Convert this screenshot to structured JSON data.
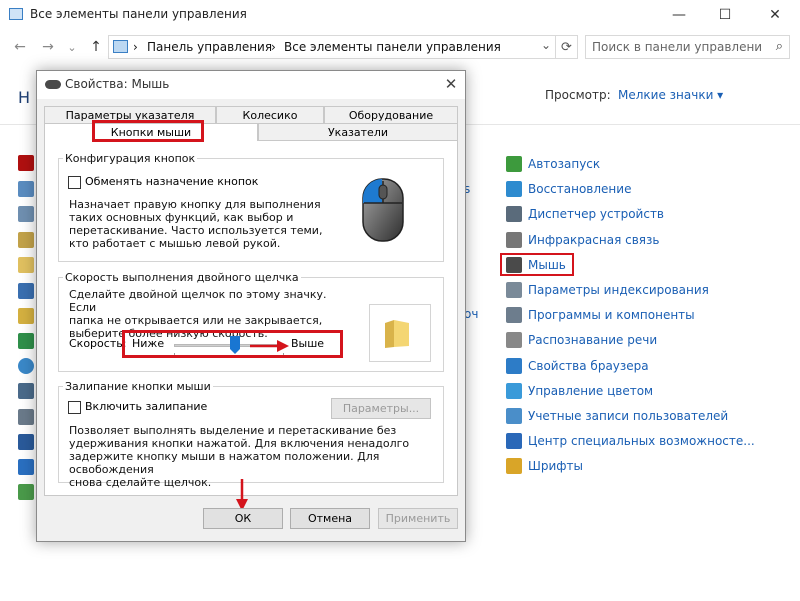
{
  "window": {
    "title": "Все элементы панели управления",
    "controls": {
      "minimize": "—",
      "maximize": "☐",
      "close": "✕"
    }
  },
  "nav": {
    "back": "←",
    "forward": "→",
    "dropdown": "⌄",
    "up": "↑"
  },
  "address": {
    "separator": "›",
    "crumbs": [
      "Панель управления",
      "Все элементы панели управления"
    ]
  },
  "search": {
    "placeholder": "Поиск в панели управления"
  },
  "header": {
    "heading_partial": "Н",
    "view_label": "Просмотр:",
    "view_value": "Мелкие значки ▾"
  },
  "right_items": [
    {
      "label": "Автозапуск",
      "icon": "autoplay-icon",
      "color": "#3d9a3d"
    },
    {
      "label": "Восстановление",
      "icon": "recovery-icon",
      "color": "#2e8bcf"
    },
    {
      "label": "Диспетчер устройств",
      "icon": "device-manager-icon",
      "color": "#5a6b7b"
    },
    {
      "label": "Инфракрасная связь",
      "icon": "infrared-icon",
      "color": "#777777"
    },
    {
      "label": "Мышь",
      "icon": "mouse-icon",
      "color": "#4a4a4a"
    },
    {
      "label": "Параметры индексирования",
      "icon": "indexing-icon",
      "color": "#7a8a99"
    },
    {
      "label": "Программы и компоненты",
      "icon": "programs-icon",
      "color": "#6d7d8d"
    },
    {
      "label": "Распознавание речи",
      "icon": "speech-icon",
      "color": "#888888"
    },
    {
      "label": "Свойства браузера",
      "icon": "browser-icon",
      "color": "#2d7cc7"
    },
    {
      "label": "Управление цветом",
      "icon": "color-management-icon",
      "color": "#3a9ad9"
    },
    {
      "label": "Учетные записи пользователей",
      "icon": "user-accounts-icon",
      "color": "#4a8ec9"
    },
    {
      "label": "Центр специальных возможносте...",
      "icon": "accessibility-icon",
      "color": "#2a68b8"
    },
    {
      "label": "Шрифты",
      "icon": "fonts-icon",
      "color": "#d9a528"
    }
  ],
  "behind_text": {
    "s": "s",
    "ochu": "оч"
  },
  "dialog": {
    "title": "Свойства: Мышь",
    "close": "✕",
    "tabs_back": [
      "Параметры указателя",
      "Колесико",
      "Оборудование"
    ],
    "tabs_front": [
      "Кнопки мыши",
      "Указатели"
    ],
    "buttons_config": {
      "title": "Конфигурация кнопок",
      "swap_label": "Обменять назначение кнопок",
      "description": [
        "Назначает правую кнопку для выполнения",
        "таких основных функций, как выбор и",
        "перетаскивание. Часто используется теми,",
        "кто работает с мышью левой рукой."
      ]
    },
    "double_click": {
      "title": "Скорость выполнения двойного щелчка",
      "description": [
        "Сделайте двойной щелчок по этому значку. Если",
        "папка не открывается или не закрывается,",
        "выберите более низкую скорость."
      ],
      "speed_label": "Скорость:",
      "low_label": "Ниже",
      "high_label": "Выше",
      "slider_value": 0.55
    },
    "click_lock": {
      "title": "Залипание кнопки мыши",
      "enable_label": "Включить залипание",
      "settings_button": "Параметры...",
      "description": [
        "Позволяет выполнять выделение и перетаскивание без",
        "удерживания кнопки нажатой. Для включения ненадолго",
        "задержите кнопку мыши в нажатом положении. Для освобождения",
        "снова сделайте щелчок."
      ]
    },
    "footer": {
      "ok": "ОК",
      "cancel": "Отмена",
      "apply": "Применить"
    }
  },
  "colors": {
    "highlight": "#d4141c",
    "link": "#1a5fb4",
    "accent": "#1976d2"
  }
}
